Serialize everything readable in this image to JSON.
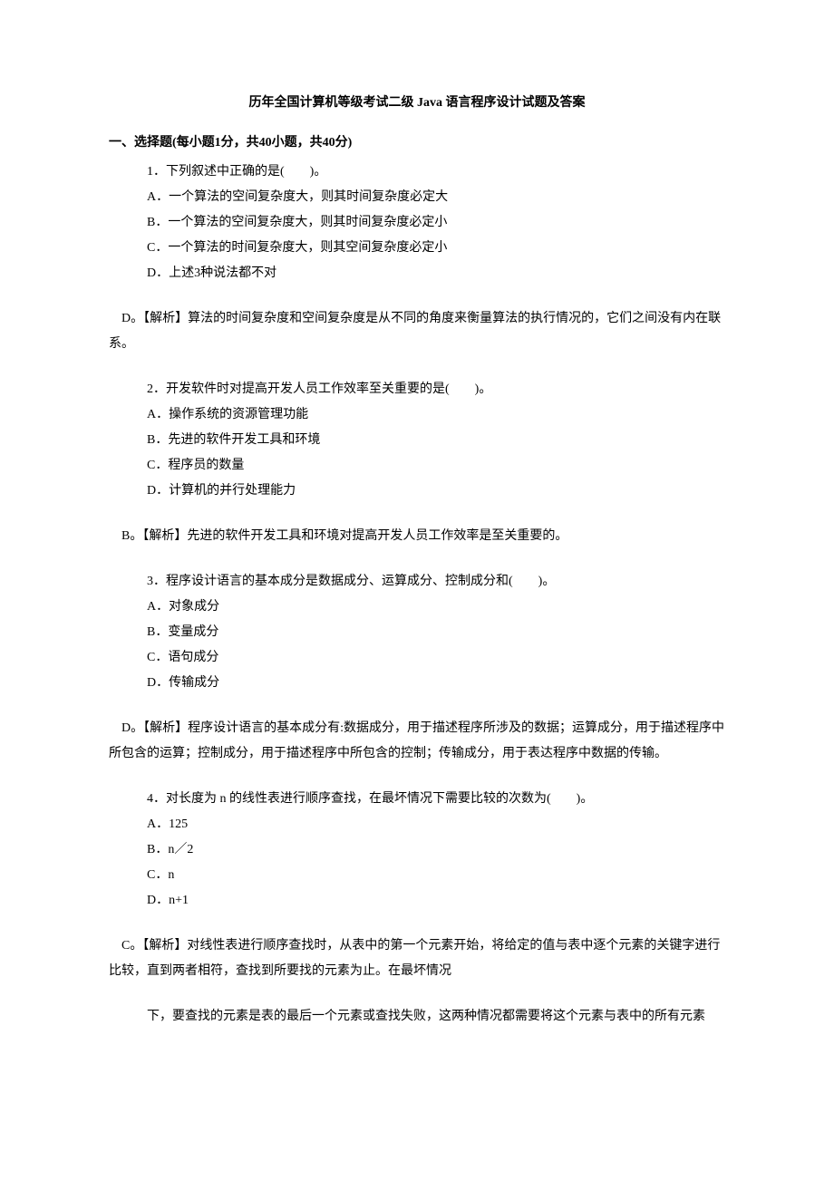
{
  "title": "历年全国计算机等级考试二级 Java 语言程序设计试题及答案",
  "section": "一、选择题(每小题1分，共40小题，共40分)",
  "q1": {
    "stem": "1．下列叙述中正确的是(　　)。",
    "a": "A．一个算法的空间复杂度大，则其时间复杂度必定大",
    "b": "B．一个算法的空间复杂度大，则其时间复杂度必定小",
    "c": "C．一个算法的时间复杂度大，则其空间复杂度必定小",
    "d": "D．上述3种说法都不对",
    "explain": " D。【解析】算法的时间复杂度和空间复杂度是从不同的角度来衡量算法的执行情况的，它们之间没有内在联系。"
  },
  "q2": {
    "stem": "2．开发软件时对提高开发人员工作效率至关重要的是(　　)。",
    "a": "A．操作系统的资源管理功能",
    "b": "B．先进的软件开发工具和环境",
    "c": "C．程序员的数量",
    "d": "D．计算机的并行处理能力",
    "explain": " B。【解析】先进的软件开发工具和环境对提高开发人员工作效率是至关重要的。"
  },
  "q3": {
    "stem": "3．程序设计语言的基本成分是数据成分、运算成分、控制成分和(　　)。",
    "a": "A．对象成分",
    "b": "B．变量成分",
    "c": "C．语句成分",
    "d": "D．传输成分",
    "explain": " D。【解析】程序设计语言的基本成分有:数据成分，用于描述程序所涉及的数据；运算成分，用于描述程序中所包含的运算；控制成分，用于描述程序中所包含的控制；传输成分，用于表达程序中数据的传输。"
  },
  "q4": {
    "stem": "4．对长度为 n 的线性表进行顺序查找，在最坏情况下需要比较的次数为(　　)。",
    "a": "A．125",
    "b": "B．n／2",
    "c": "C．n",
    "d": "D．n+1",
    "explain": " C。【解析】对线性表进行顺序查找时，从表中的第一个元素开始，将给定的值与表中逐个元素的关键字进行比较，直到两者相符，查找到所要找的元素为止。在最坏情况",
    "explain_cont": "下，要查找的元素是表的最后一个元素或查找失败，这两种情况都需要将这个元素与表中的所有元素"
  }
}
